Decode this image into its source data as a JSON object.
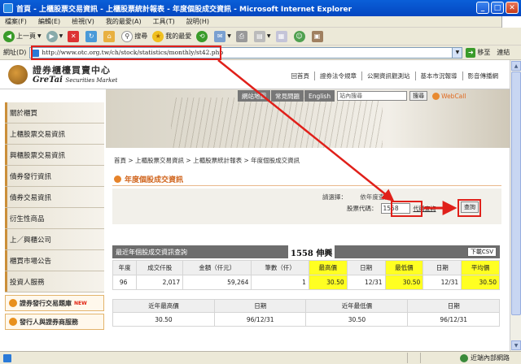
{
  "window": {
    "title": "首頁 - 上櫃股票交易資訊 - 上櫃股票統計報表 - 年度個股成交資訊 - Microsoft Internet Explorer"
  },
  "menu": [
    "檔案(F)",
    "編輯(E)",
    "檢視(V)",
    "我的最愛(A)",
    "工具(T)",
    "說明(H)"
  ],
  "toolbar": {
    "back_label": "上一頁",
    "search_label": "搜尋",
    "favorites_label": "我的最愛"
  },
  "address": {
    "label": "網址(D)",
    "url": "http://www.otc.org.tw/ch/stock/statistics/monthly/st42.php",
    "go_label": "移至",
    "links_label": "連結"
  },
  "site": {
    "logo_cn": "證券櫃檯買賣中心",
    "logo_en": "GreTai",
    "logo_en_small": "Securities Market",
    "top_links": [
      "回首頁",
      "證券法令規章",
      "公開資訊觀測站",
      "基本市況報導",
      "影音傳播網"
    ],
    "nav_buttons": [
      "網站地圖",
      "常見問題",
      "English"
    ],
    "search_placeholder": "站內搜尋",
    "search_btn": "搜尋",
    "webcall": "WebCall"
  },
  "sidebar": {
    "items": [
      "關於櫃買",
      "上櫃股票交易資訊",
      "興櫃股票交易資訊",
      "債券發行資訊",
      "債券交易資訊",
      "衍生性商品",
      "上／興櫃公司",
      "櫃買市場公告",
      "投資人服務"
    ],
    "promo1": "證券發行交易題庫",
    "promo1_tag": "NEW",
    "promo2": "發行人與證券商服務"
  },
  "breadcrumb": "首頁 > 上櫃股票交易資訊 > 上櫃股票統計報表 > 年度個股成交資訊",
  "section_title": "年度個股成交資訊",
  "form": {
    "select_label": "請選擇：",
    "select_hint": "依年度查詢",
    "code_label": "股票代碼：",
    "code_value": "1558",
    "code_link": "代碼查詢",
    "query_btn": "查詢"
  },
  "results": {
    "header": "最近年個股成交資訊查詢",
    "stock_title": "1558 伸興",
    "csv_btn": "下載CSV",
    "columns": [
      "年度",
      "成交仟股",
      "金額（仟元）",
      "筆數（仟）",
      "最高價",
      "日期",
      "最低價",
      "日期",
      "平均價"
    ],
    "row": [
      "96",
      "2,017",
      "59,264",
      "1",
      "30.50",
      "12/31",
      "30.50",
      "12/31",
      "30.50"
    ]
  },
  "summary": {
    "columns": [
      "近年最高價",
      "日期",
      "近年最低價",
      "日期"
    ],
    "row": [
      "30.50",
      "96/12/31",
      "30.50",
      "96/12/31"
    ]
  },
  "status": {
    "zone": "近端內部網路"
  },
  "colors": {
    "annotation_red": "#e0201a",
    "highlight_yellow": "#ffff22",
    "accent_orange": "#d0641c"
  }
}
